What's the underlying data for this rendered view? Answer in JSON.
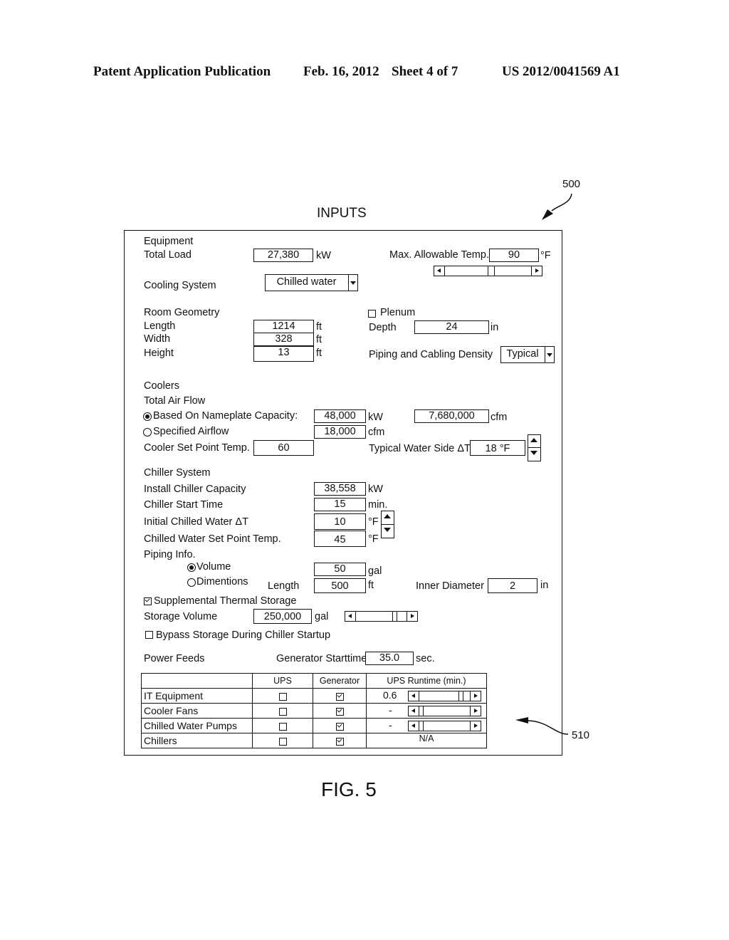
{
  "header": {
    "left": "Patent Application Publication",
    "date": "Feb. 16, 2012",
    "sheet": "Sheet 4 of 7",
    "number": "US 2012/0041569 A1"
  },
  "figure": {
    "ref_main": "500",
    "ref_table": "510",
    "title": "INPUTS",
    "caption": "FIG. 5"
  },
  "equipment": {
    "section": "Equipment",
    "total_load_label": "Total Load",
    "total_load_value": "27,380",
    "total_load_unit": "kW",
    "max_temp_label": "Max. Allowable Temp.",
    "max_temp_value": "90",
    "max_temp_unit": "°F",
    "max_temp_slider_fraction": 0.55,
    "cooling_system_label": "Cooling System",
    "cooling_system_value": "Chilled water"
  },
  "room": {
    "section": "Room Geometry",
    "length_label": "Length",
    "length_value": "1214",
    "length_unit": "ft",
    "width_label": "Width",
    "width_value": "328",
    "width_unit": "ft",
    "height_label": "Height",
    "height_value": "13",
    "height_unit": "ft",
    "plenum_label": "Plenum",
    "plenum_checked": false,
    "depth_label": "Depth",
    "depth_value": "24",
    "depth_unit": "in",
    "density_label": "Piping and Cabling Density",
    "density_value": "Typical"
  },
  "coolers": {
    "section": "Coolers",
    "airflow_label": "Total Air Flow",
    "nameplate_label": "Based On Nameplate Capacity:",
    "nameplate_selected": true,
    "nameplate_value": "48,000",
    "nameplate_unit": "kW",
    "nameplate_cfm_value": "7,680,000",
    "nameplate_cfm_unit": "cfm",
    "specified_label": "Specified Airflow",
    "specified_selected": false,
    "specified_value": "18,000",
    "specified_unit": "cfm",
    "setpoint_label": "Cooler Set Point Temp.",
    "setpoint_value": "60",
    "water_dt_label": "Typical Water Side ΔT",
    "water_dt_value": "18 °F"
  },
  "chiller": {
    "section": "Chiller System",
    "capacity_label": "Install Chiller Capacity",
    "capacity_value": "38,558",
    "capacity_unit": "kW",
    "start_label": "Chiller Start Time",
    "start_value": "15",
    "start_unit": "min.",
    "initial_dt_label": "Initial Chilled Water ΔT",
    "initial_dt_value": "10",
    "initial_dt_unit": "°F",
    "setpoint_label": "Chilled Water Set Point Temp.",
    "setpoint_value": "45",
    "setpoint_unit": "°F",
    "piping_label": "Piping Info.",
    "volume_label": "Volume",
    "volume_selected": true,
    "volume_value": "50",
    "volume_unit": "gal",
    "dimensions_label": "Dimentions",
    "dimensions_selected": false,
    "length_label": "Length",
    "length_value": "500",
    "length_unit": "ft",
    "diameter_label": "Inner Diameter",
    "diameter_value": "2",
    "diameter_unit": "in"
  },
  "storage": {
    "supplemental_label": "Supplemental Thermal Storage",
    "supplemental_checked": true,
    "volume_label": "Storage Volume",
    "volume_value": "250,000",
    "volume_unit": "gal",
    "volume_slider_fraction": 0.85,
    "bypass_label": "Bypass Storage During Chiller Startup",
    "bypass_checked": false
  },
  "power": {
    "section": "Power Feeds",
    "gen_start_label": "Generator Starttime",
    "gen_start_value": "35.0",
    "gen_start_unit": "sec.",
    "columns": [
      "",
      "UPS",
      "Generator",
      "UPS Runtime (min.)"
    ],
    "rows": [
      {
        "name": "IT Equipment",
        "ups": false,
        "generator": true,
        "runtime": "0.6",
        "slider": true,
        "slider_fraction": 0.9
      },
      {
        "name": "Cooler Fans",
        "ups": false,
        "generator": true,
        "runtime": "-",
        "slider": true,
        "slider_fraction": 0.05
      },
      {
        "name": "Chilled Water Pumps",
        "ups": false,
        "generator": true,
        "runtime": "-",
        "slider": true,
        "slider_fraction": 0.05
      },
      {
        "name": "Chillers",
        "ups": false,
        "generator": true,
        "runtime": "N/A",
        "slider": false
      }
    ]
  }
}
